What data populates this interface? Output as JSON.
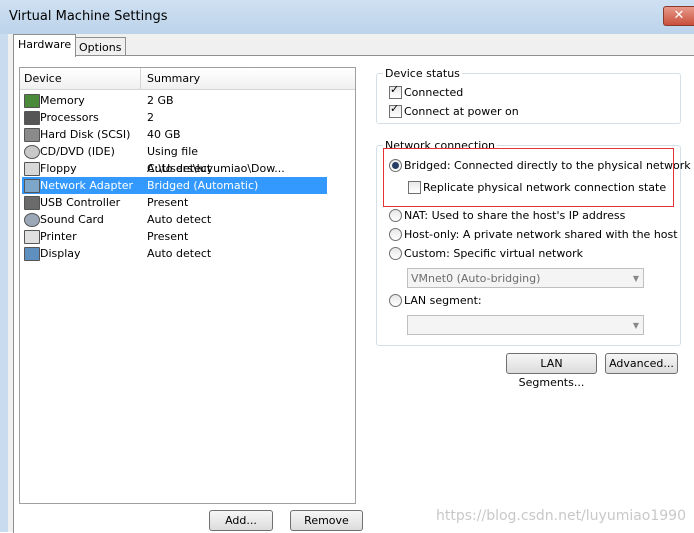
{
  "window": {
    "title": "Virtual Machine Settings",
    "close_glyph": "✕"
  },
  "tabs": [
    {
      "label": "Hardware",
      "active": true
    },
    {
      "label": "Options",
      "active": false
    }
  ],
  "devices": {
    "columns": [
      "Device",
      "Summary"
    ],
    "rows": [
      {
        "name": "Memory",
        "summary": "2 GB",
        "icon": "memory-icon"
      },
      {
        "name": "Processors",
        "summary": "2",
        "icon": "processor-icon"
      },
      {
        "name": "Hard Disk (SCSI)",
        "summary": "40 GB",
        "icon": "hard-disk-icon"
      },
      {
        "name": "CD/DVD (IDE)",
        "summary": "Using file C:\\Users\\luyumiao\\Dow...",
        "icon": "cd-dvd-icon"
      },
      {
        "name": "Floppy",
        "summary": "Auto detect",
        "icon": "floppy-icon"
      },
      {
        "name": "Network Adapter",
        "summary": "Bridged (Automatic)",
        "icon": "network-adapter-icon",
        "selected": true
      },
      {
        "name": "USB Controller",
        "summary": "Present",
        "icon": "usb-icon"
      },
      {
        "name": "Sound Card",
        "summary": "Auto detect",
        "icon": "sound-card-icon"
      },
      {
        "name": "Printer",
        "summary": "Present",
        "icon": "printer-icon"
      },
      {
        "name": "Display",
        "summary": "Auto detect",
        "icon": "display-icon"
      }
    ],
    "add_label": "Add...",
    "remove_label": "Remove"
  },
  "device_status": {
    "title": "Device status",
    "connected": {
      "label": "Connected",
      "checked": true
    },
    "connect_at_power_on": {
      "label": "Connect at power on",
      "checked": true
    }
  },
  "network_connection": {
    "title": "Network connection",
    "bridged": {
      "label": "Bridged: Connected directly to the physical network",
      "selected": true
    },
    "replicate": {
      "label": "Replicate physical network connection state",
      "checked": false
    },
    "nat": {
      "label": "NAT: Used to share the host's IP address",
      "selected": false
    },
    "host_only": {
      "label": "Host-only: A private network shared with the host",
      "selected": false
    },
    "custom": {
      "label": "Custom: Specific virtual network",
      "selected": false
    },
    "vmnet_value": "VMnet0 (Auto-bridging)",
    "lan_segment": {
      "label": "LAN segment:",
      "selected": false
    },
    "lan_segment_value": ""
  },
  "buttons": {
    "lan_segments": "LAN Segments...",
    "advanced": "Advanced..."
  },
  "watermark": "https://blog.csdn.net/luyumiao1990",
  "colors": {
    "selection": "#3399ff",
    "highlight_box": "#e53333"
  }
}
